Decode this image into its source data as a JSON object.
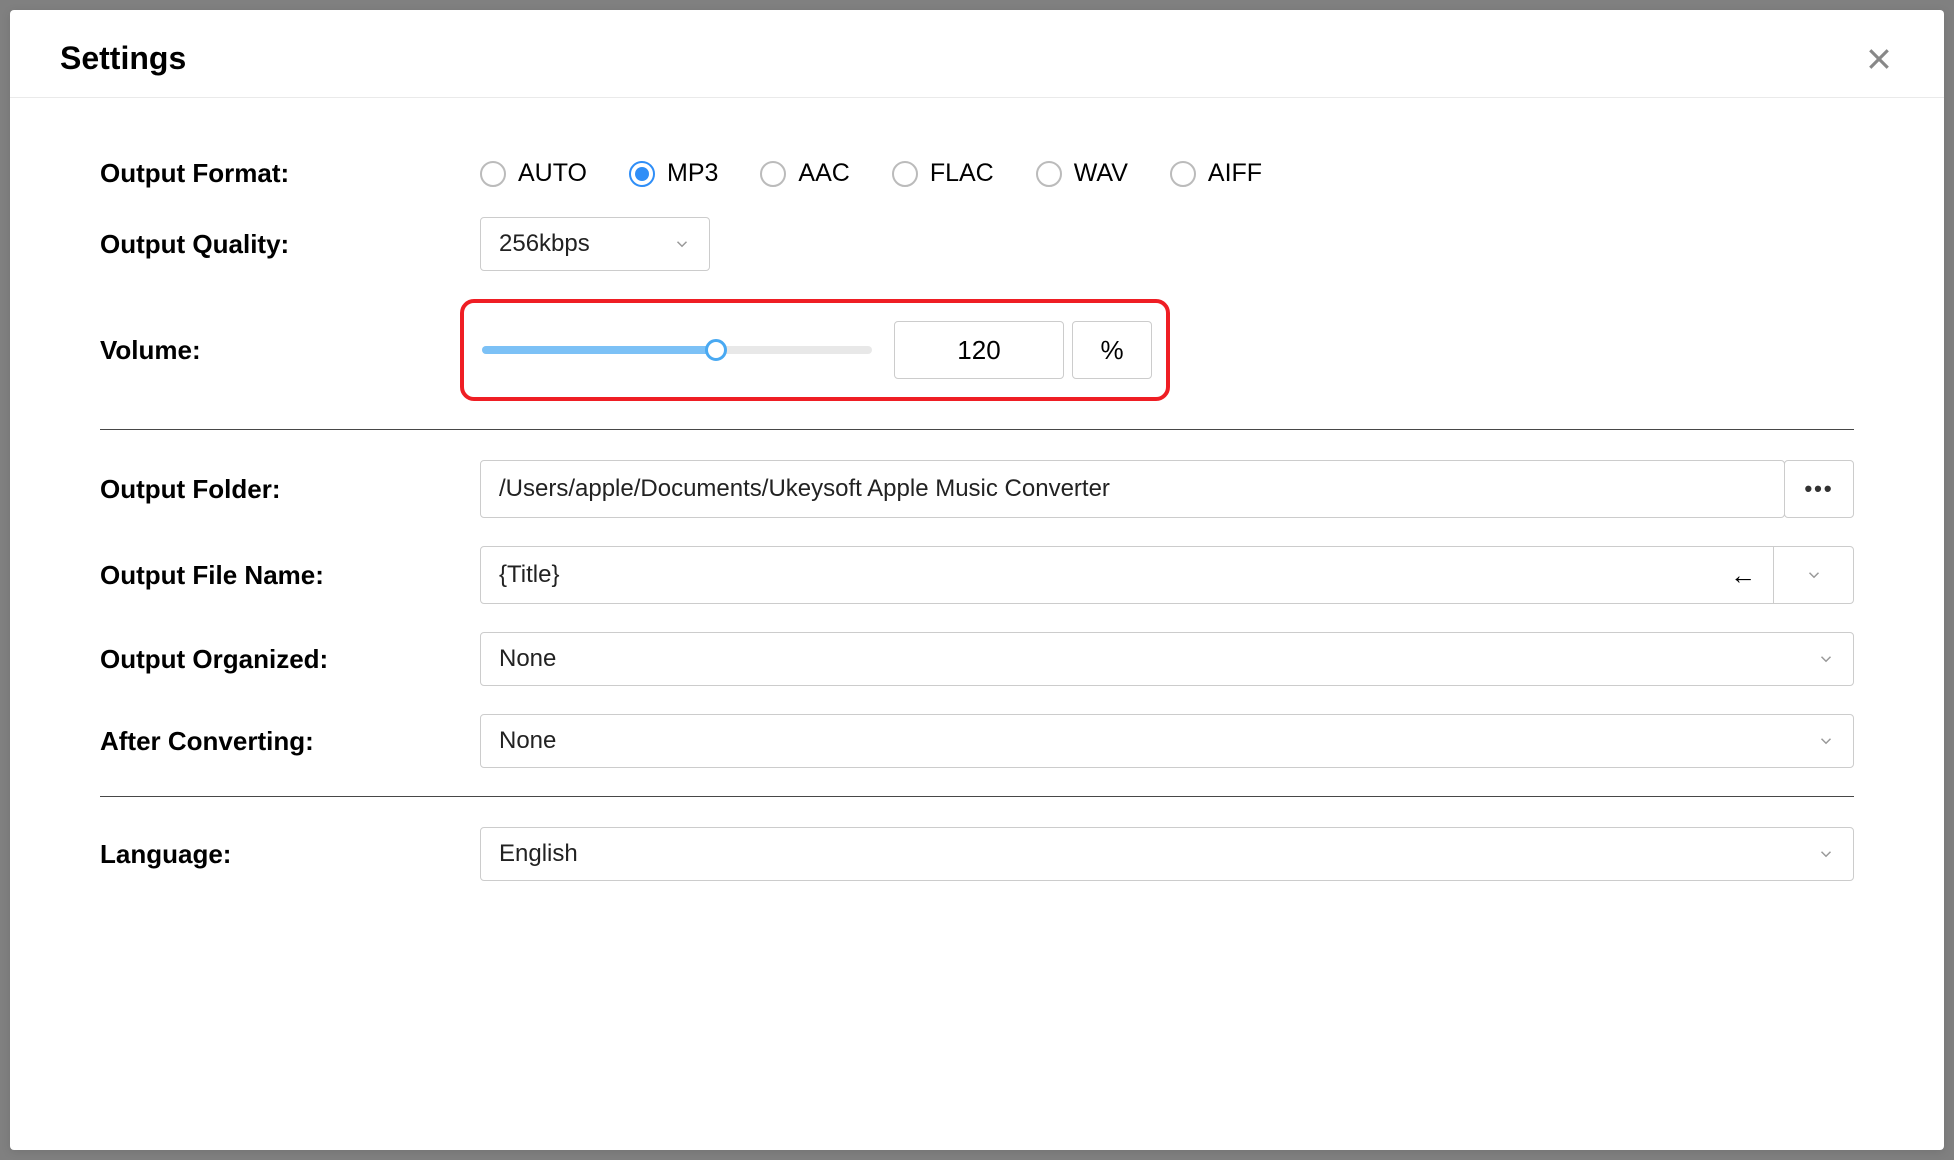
{
  "title": "Settings",
  "labels": {
    "output_format": "Output Format:",
    "output_quality": "Output Quality:",
    "volume": "Volume:",
    "output_folder": "Output Folder:",
    "output_file_name": "Output File Name:",
    "output_organized": "Output Organized:",
    "after_converting": "After Converting:",
    "language": "Language:"
  },
  "output_format": {
    "options": [
      "AUTO",
      "MP3",
      "AAC",
      "FLAC",
      "WAV",
      "AIFF"
    ],
    "selected": "MP3"
  },
  "output_quality": {
    "value": "256kbps"
  },
  "volume": {
    "value": "120",
    "unit": "%",
    "slider_percent": 60
  },
  "output_folder": {
    "value": "/Users/apple/Documents/Ukeysoft Apple Music Converter"
  },
  "output_file_name": {
    "value": "{Title}"
  },
  "output_organized": {
    "value": "None"
  },
  "after_converting": {
    "value": "None"
  },
  "language": {
    "value": "English"
  },
  "browse_dots": "•••",
  "back_arrow": "←"
}
